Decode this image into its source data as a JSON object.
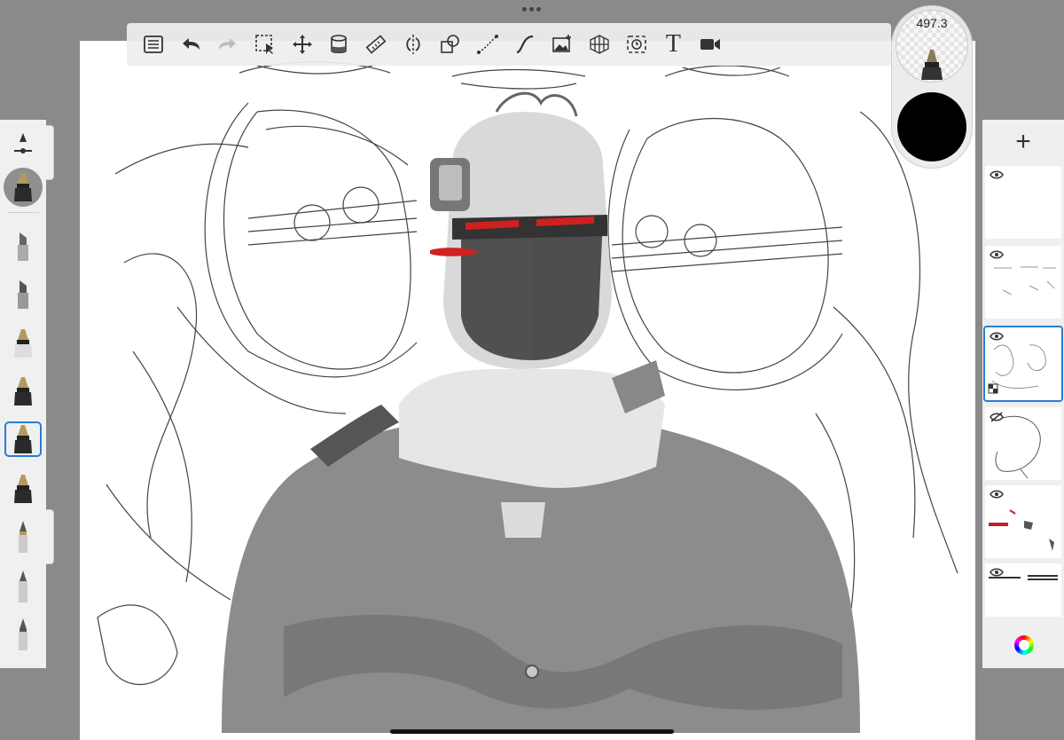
{
  "app": {
    "accent_color": "#2a7bd8",
    "toolbar_background": "#eeeeee",
    "canvas_background": "#ffffff"
  },
  "toolbar": {
    "tools": [
      {
        "id": "list",
        "icon": "list-icon"
      },
      {
        "id": "undo",
        "icon": "undo-icon"
      },
      {
        "id": "redo",
        "icon": "redo-icon",
        "disabled": true
      },
      {
        "id": "selection",
        "icon": "selection-icon"
      },
      {
        "id": "transform",
        "icon": "move-icon"
      },
      {
        "id": "fill",
        "icon": "paint-bucket-icon"
      },
      {
        "id": "ruler",
        "icon": "ruler-icon"
      },
      {
        "id": "symmetry",
        "icon": "symmetry-icon"
      },
      {
        "id": "shapes",
        "icon": "shapes-icon"
      },
      {
        "id": "steady-stroke",
        "icon": "steady-stroke-icon"
      },
      {
        "id": "predictive-stroke",
        "icon": "curve-icon"
      },
      {
        "id": "import-image",
        "icon": "image-icon"
      },
      {
        "id": "perspective",
        "icon": "perspective-grid-icon"
      },
      {
        "id": "time-lapse",
        "icon": "timelapse-icon"
      },
      {
        "id": "text",
        "icon": "text-icon",
        "label": "T"
      },
      {
        "id": "record",
        "icon": "video-icon"
      }
    ]
  },
  "brush_puck": {
    "size_value": "497.3",
    "current_color": "#000000"
  },
  "brush_library": {
    "items": [
      {
        "id": "brush-settings",
        "icon": "brush-settings-icon"
      },
      {
        "id": "current-brush",
        "icon": "ink-pen-icon"
      },
      {
        "id": "marker-1",
        "icon": "marker-icon"
      },
      {
        "id": "marker-2",
        "icon": "marker-icon"
      },
      {
        "id": "ink-1",
        "icon": "ink-pen-icon"
      },
      {
        "id": "ink-2",
        "icon": "ink-pen-icon"
      },
      {
        "id": "ink-3",
        "icon": "ink-pen-icon",
        "selected": true
      },
      {
        "id": "ink-4",
        "icon": "ink-pen-icon"
      },
      {
        "id": "pencil-1",
        "icon": "pencil-icon"
      },
      {
        "id": "pencil-2",
        "icon": "pencil-icon"
      },
      {
        "id": "pencil-3",
        "icon": "pencil-icon"
      }
    ]
  },
  "layers": {
    "add_label": "+",
    "items": [
      {
        "id": "layer-1",
        "visible": true
      },
      {
        "id": "layer-2",
        "visible": true
      },
      {
        "id": "layer-3",
        "visible": true,
        "selected": true
      },
      {
        "id": "layer-4",
        "visible": false
      },
      {
        "id": "layer-5",
        "visible": true
      },
      {
        "id": "layer-6",
        "visible": true
      }
    ]
  }
}
